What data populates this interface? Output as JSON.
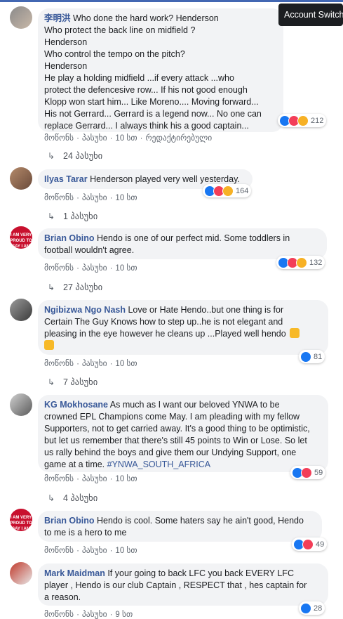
{
  "tooltip": "Account Switcher",
  "comments": [
    {
      "author": "李明洪",
      "text_lines": [
        "Who done the hard work? Henderson",
        "Who protect the back line on midfield ?",
        "Henderson",
        "Who control the tempo on the pitch?",
        "Henderson",
        "He play a holding midfield ...if every attack ...who",
        "protect the defencesive row... If his not good enough",
        "Klopp won start him... Like Moreno.... Moving forward...",
        "His not Gerrard... Gerrard is a legend now... No one can",
        "replace Gerrard... I always think his a good captain..."
      ],
      "reactions": "212",
      "like": "მოწონს",
      "reply": "პასუხი",
      "time": "10 სთ",
      "edited": "რედაქტირებული",
      "replies": "24 პასუხი"
    },
    {
      "author": "Ilyas Tarar",
      "text": "Henderson played very well yesterday.",
      "reactions": "164",
      "like": "მოწონს",
      "reply": "პასუხი",
      "time": "10 სთ",
      "replies": "1 პასუხი"
    },
    {
      "author": "Brian Obino",
      "text_lines": [
        "Hendo is one of our perfect mid. Some toddlers in",
        "football wouldn't agree."
      ],
      "reactions": "132",
      "like": "მოწონს",
      "reply": "პასუხი",
      "time": "10 სთ",
      "replies": "27 პასუხი",
      "avatar_text": "I AM VERY PROUD TO SAY I AM"
    },
    {
      "author": "Ngibizwa Ngo Nash",
      "text_lines": [
        "Love or Hate Hendo..but one thing is for",
        "Certain The Guy Knows how to step up..he is not elegant and",
        "pleasing in the eye however he cleans up ...Played well hendo"
      ],
      "reactions": "81",
      "like": "მოწონს",
      "reply": "პასუხი",
      "time": "10 სთ",
      "replies": "7 პასუხი"
    },
    {
      "author": "KG Mokhosane",
      "text_lines": [
        "As much as I want our beloved YNWA to be",
        "crowned EPL Champions come May. I am pleading with my fellow",
        "Supporters, not to get carried away. It's a good thing to be optimistic,",
        "but let us remember that there's still 45 points to Win or Lose. So let",
        "us rally behind the boys and give them our Undying Support, one",
        "game at a time."
      ],
      "hashtag": "#YNWA_SOUTH_AFRICA",
      "reactions": "59",
      "like": "მოწონს",
      "reply": "პასუხი",
      "time": "10 სთ",
      "replies": "4 პასუხი"
    },
    {
      "author": "Brian Obino",
      "text_lines": [
        "Hendo is cool. Some haters say he ain't good, Hendo",
        "to me is a hero to me"
      ],
      "reactions": "49",
      "like": "მოწონს",
      "reply": "პასუხი",
      "time": "10 სთ",
      "avatar_text": "I AM VERY PROUD TO SAY I AM"
    },
    {
      "author": "Mark Maidman",
      "text_lines": [
        "If your going to back LFC you back EVERY LFC",
        "player , Hendo is our club Captain , RESPECT that , hes captain for",
        "a reason."
      ],
      "reactions": "28",
      "like": "მოწონს",
      "reply": "პასუხი",
      "time": "9 სთ"
    }
  ]
}
